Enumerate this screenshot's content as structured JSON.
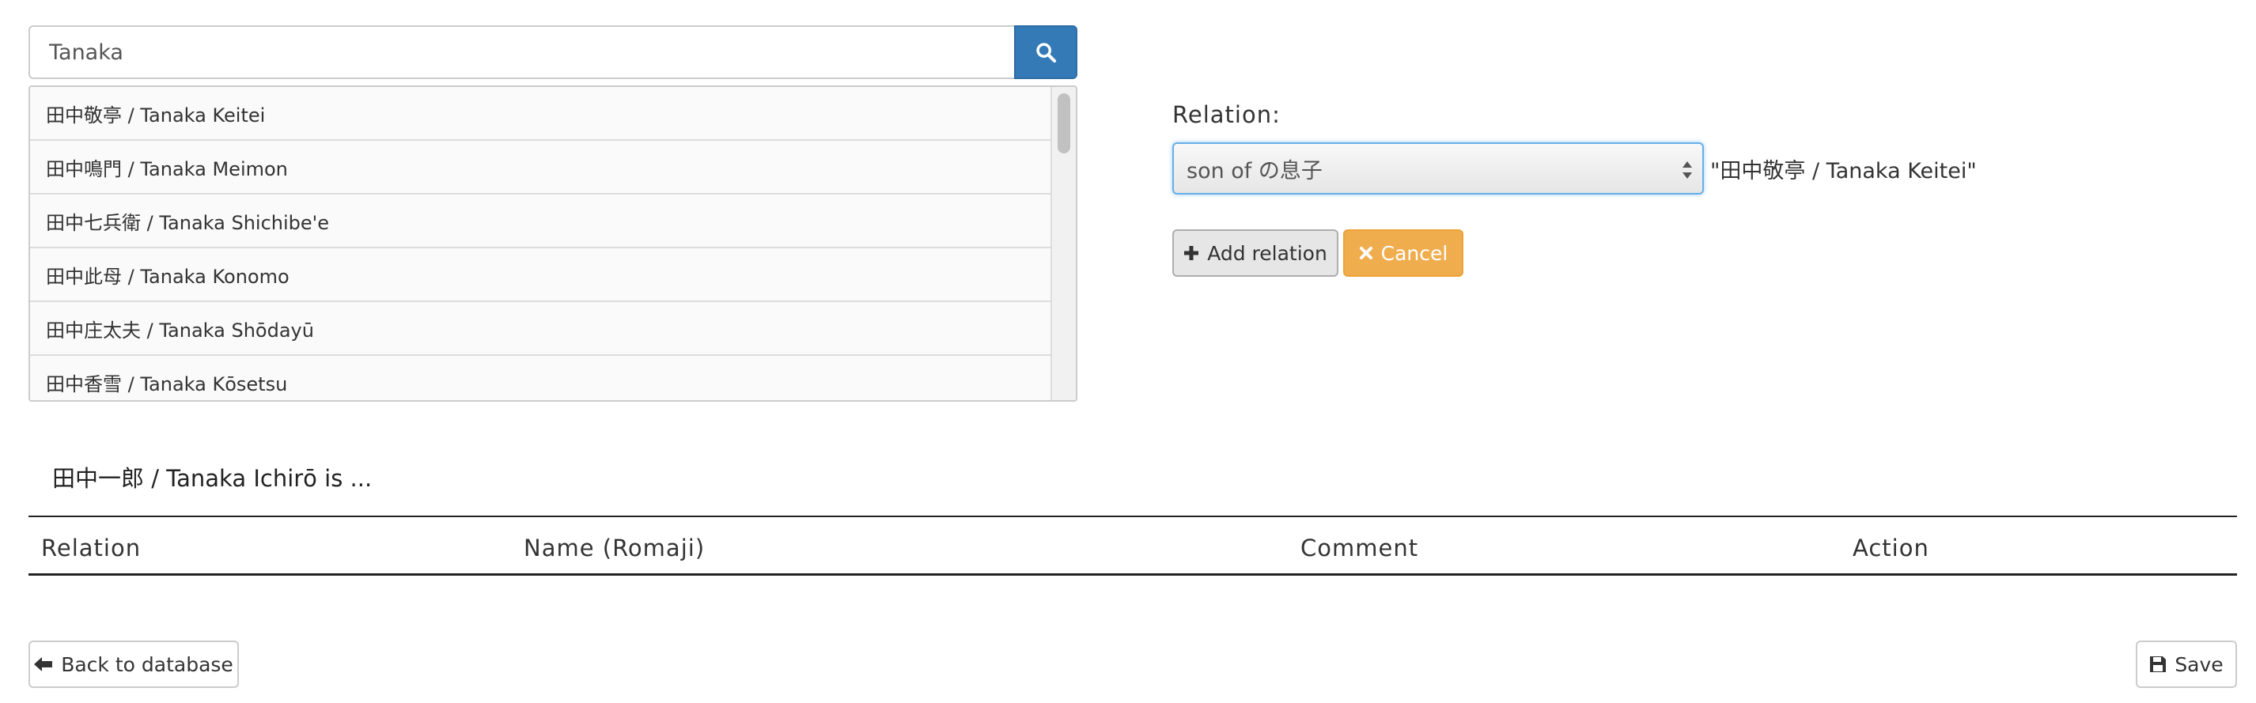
{
  "search": {
    "value": "Tanaka",
    "button_icon": "search-icon"
  },
  "results": [
    "田中敬亭 / Tanaka Keitei",
    "田中鳴門 / Tanaka Meimon",
    "田中七兵衛 / Tanaka Shichibe'e",
    "田中此母 / Tanaka Konomo",
    "田中庄太夫 / Tanaka Shōdayū",
    "田中香雪 / Tanaka Kōsetsu"
  ],
  "relation": {
    "label": "Relation:",
    "selected": "son of の息子",
    "target": "\"田中敬亭 / Tanaka Keitei\"",
    "add_label": "Add relation",
    "cancel_label": "Cancel"
  },
  "subject": "田中一郎 / Tanaka Ichirō is ...",
  "table": {
    "headers": [
      "Relation",
      "Name (Romaji)",
      "Comment",
      "Action"
    ]
  },
  "footer": {
    "back_label": "Back to database",
    "save_label": "Save"
  },
  "colors": {
    "primary": "#337ab7",
    "warning": "#f0ad4e",
    "focus": "#66afe9"
  }
}
